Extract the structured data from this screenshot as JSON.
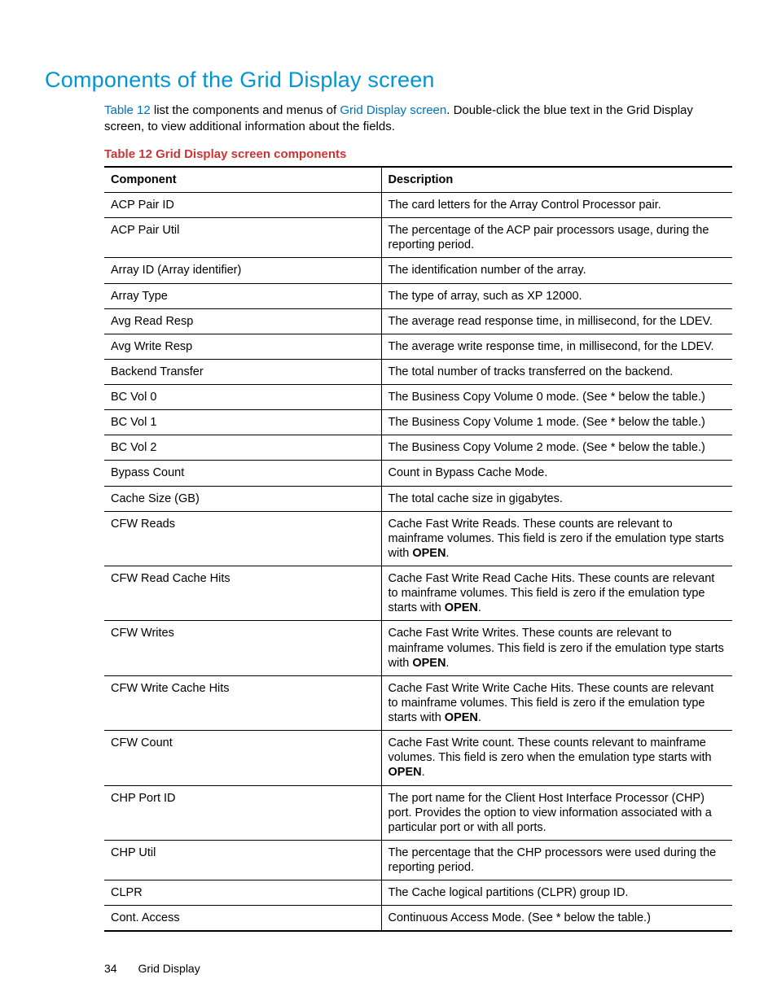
{
  "heading": "Components of the Grid Display screen",
  "intro": {
    "link1_text": "Table 12",
    "mid1": " list the components and menus of ",
    "link2_text": "Grid Display screen",
    "mid2": ".  Double-click the blue text in the Grid Display screen, to view additional information about the fields."
  },
  "table_caption": "Table 12 Grid Display screen components",
  "columns": {
    "component": "Component",
    "description": "Description"
  },
  "rows": [
    {
      "component": "ACP Pair ID",
      "description": "The card letters for the Array Control Processor pair."
    },
    {
      "component": "ACP Pair Util",
      "description": "The percentage of the ACP pair processors usage, during the reporting period."
    },
    {
      "component": "Array ID (Array identifier)",
      "description": "The identification number of the array."
    },
    {
      "component": "Array Type",
      "description": "The type of array, such as XP 12000."
    },
    {
      "component": "Avg Read Resp",
      "description": "The average read response time, in millisecond, for the LDEV."
    },
    {
      "component": "Avg Write Resp",
      "description": "The average write response time, in millisecond, for the LDEV."
    },
    {
      "component": "Backend Transfer",
      "description": "The total number of tracks transferred on the backend."
    },
    {
      "component": "BC Vol 0",
      "description": "The Business Copy Volume 0 mode.  (See * below the table.)"
    },
    {
      "component": "BC Vol 1",
      "description": "The Business Copy Volume 1 mode.  (See * below the table.)"
    },
    {
      "component": "BC Vol 2",
      "description": "The Business Copy Volume 2 mode.  (See * below the table.)"
    },
    {
      "component": "Bypass Count",
      "description": "Count in Bypass Cache Mode."
    },
    {
      "component": "Cache Size (GB)",
      "description": "The total cache size in gigabytes."
    },
    {
      "component": "CFW Reads",
      "description_pre": "Cache Fast Write Reads.  These counts are relevant to mainframe volumes.  This field is zero if the emulation type starts with ",
      "description_bold": "OPEN",
      "description_post": "."
    },
    {
      "component": "CFW Read Cache Hits",
      "description_pre": "Cache Fast Write Read Cache Hits.  These counts are relevant to mainframe volumes.  This field is zero if the emulation type starts with ",
      "description_bold": "OPEN",
      "description_post": "."
    },
    {
      "component": "CFW Writes",
      "description_pre": "Cache Fast Write Writes.  These counts are relevant to mainframe volumes.  This field is zero if the emulation type starts with ",
      "description_bold": "OPEN",
      "description_post": "."
    },
    {
      "component": "CFW Write Cache Hits",
      "description_pre": "Cache Fast Write Write Cache Hits.  These counts are relevant to mainframe volumes.  This field is zero if the emulation type starts with ",
      "description_bold": "OPEN",
      "description_post": "."
    },
    {
      "component": "CFW Count",
      "description_pre": "Cache Fast Write count.  These counts relevant to mainframe volumes.  This field is zero when the emulation type starts with ",
      "description_bold": "OPEN",
      "description_post": "."
    },
    {
      "component": "CHP Port ID",
      "description": "The port name for the Client Host Interface Processor (CHP) port.  Provides the option to view information associated with a particular port or with all ports."
    },
    {
      "component": "CHP Util",
      "description": "The percentage that the CHP processors were used during the reporting period."
    },
    {
      "component": "CLPR",
      "description": "The Cache logical partitions (CLPR) group ID."
    },
    {
      "component": "Cont. Access",
      "description": "Continuous Access Mode.  (See * below the table.)"
    }
  ],
  "footer": {
    "page_number": "34",
    "section": "Grid Display"
  }
}
